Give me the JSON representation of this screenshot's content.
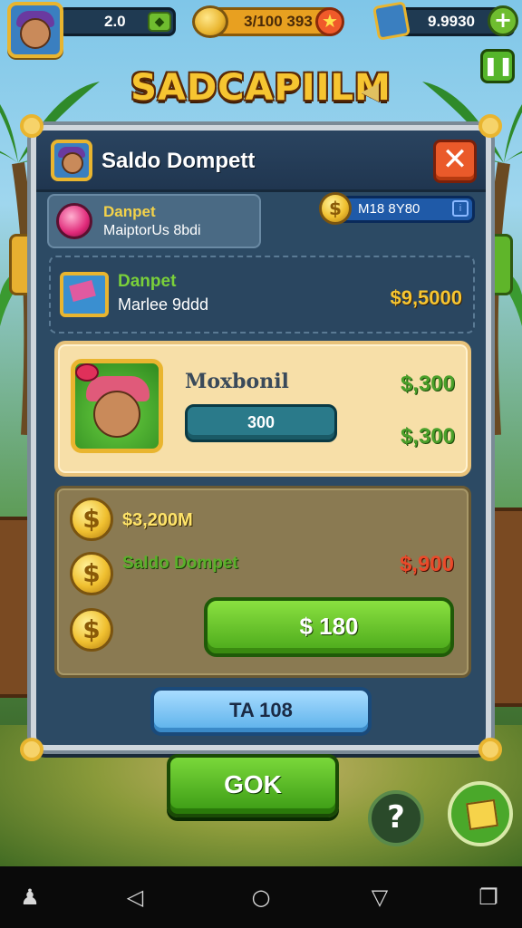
{
  "hud": {
    "level": "2.0",
    "coins": "3/100  393",
    "cash": "9.9930",
    "pause_icon": "pause-icon",
    "plus_icon": "plus-icon"
  },
  "game_title": "SADCAPIILM",
  "dialog": {
    "title": "Saldo Dompett",
    "close_icon": "close-icon",
    "balance": "M18 8Y80",
    "info_row": {
      "title": "Danpet",
      "subtitle": "MaiptorUs 8bdi"
    },
    "map_row": {
      "title": "Danpet",
      "subtitle": "Marlee 9ddd",
      "value": "$9,5000"
    },
    "character_card": {
      "name": "Moxbonil",
      "bar_value": "300",
      "value_top": "$,300",
      "value_bottom": "$,300"
    },
    "wallet": {
      "amount": "$3,200M",
      "label": "Saldo Dompet",
      "red_value": "$,900",
      "buy_label": "$ 180"
    },
    "tab_label": "TA 108"
  },
  "ok_label": "GOK",
  "help_label": "?",
  "colors": {
    "gold": "#f6c531",
    "green_button": "#4aa81a",
    "blue_button": "#5ab0ea",
    "dialog_bg": "#2c4a64",
    "close_red": "#ea5a2a"
  }
}
